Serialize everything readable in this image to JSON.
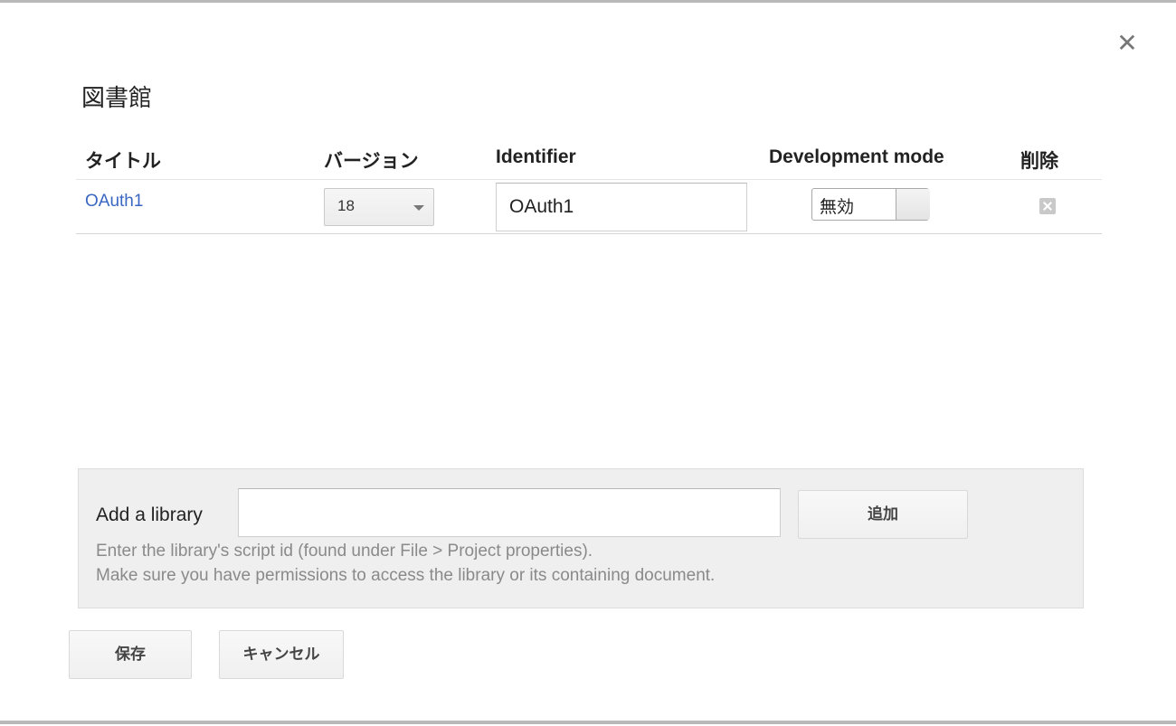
{
  "dialog": {
    "title": "図書館",
    "close_glyph": "✕"
  },
  "table": {
    "headers": {
      "title": "タイトル",
      "version": "バージョン",
      "identifier": "Identifier",
      "dev_mode": "Development mode",
      "delete": "削除"
    },
    "rows": [
      {
        "title": "OAuth1",
        "version": "18",
        "identifier": "OAuth1",
        "dev_mode_label": "無効",
        "dev_mode_enabled": false
      }
    ]
  },
  "add_library": {
    "label": "Add a library",
    "input_value": "",
    "button_label": "追加",
    "help_line1": "Enter the library's script id (found under File > Project properties).",
    "help_line2": "Make sure you have permissions to access the library or its containing document."
  },
  "footer": {
    "save_label": "保存",
    "cancel_label": "キャンセル"
  },
  "colors": {
    "link": "#3a67c1",
    "panel_bg": "#efefef",
    "help_text": "#8a8a8a"
  }
}
